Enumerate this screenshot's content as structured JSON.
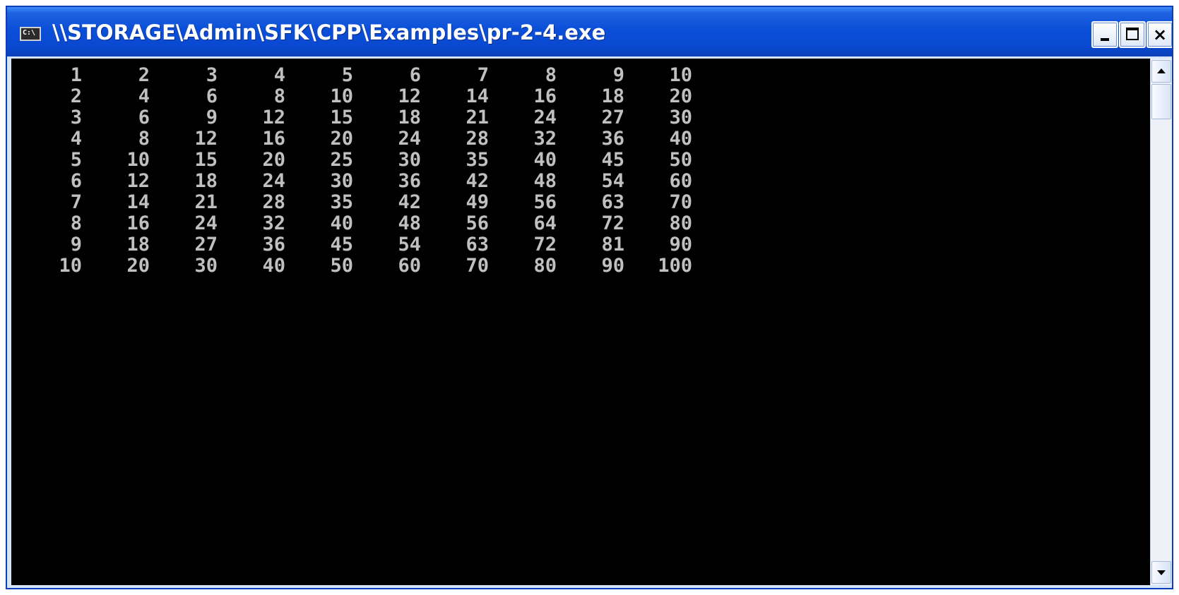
{
  "window": {
    "title": "\\\\STORAGE\\Admin\\SFK\\CPP\\Examples\\pr-2-4.exe",
    "icon": "console-icon",
    "icon_text": "C:\\",
    "controls": {
      "minimize_icon": "minimize-icon",
      "maximize_icon": "maximize-icon",
      "close_icon": "close-icon",
      "close_glyph": "×"
    }
  },
  "console": {
    "background": "#000000",
    "text_color": "#c0c0c0",
    "rows": [
      [
        "1",
        "2",
        "3",
        "4",
        "5",
        "6",
        "7",
        "8",
        "9",
        "10"
      ],
      [
        "2",
        "4",
        "6",
        "8",
        "10",
        "12",
        "14",
        "16",
        "18",
        "20"
      ],
      [
        "3",
        "6",
        "9",
        "12",
        "15",
        "18",
        "21",
        "24",
        "27",
        "30"
      ],
      [
        "4",
        "8",
        "12",
        "16",
        "20",
        "24",
        "28",
        "32",
        "36",
        "40"
      ],
      [
        "5",
        "10",
        "15",
        "20",
        "25",
        "30",
        "35",
        "40",
        "45",
        "50"
      ],
      [
        "6",
        "12",
        "18",
        "24",
        "30",
        "36",
        "42",
        "48",
        "54",
        "60"
      ],
      [
        "7",
        "14",
        "21",
        "28",
        "35",
        "42",
        "49",
        "56",
        "63",
        "70"
      ],
      [
        "8",
        "16",
        "24",
        "32",
        "40",
        "48",
        "56",
        "64",
        "72",
        "80"
      ],
      [
        "9",
        "18",
        "27",
        "36",
        "45",
        "54",
        "63",
        "72",
        "81",
        "90"
      ],
      [
        "10",
        "20",
        "30",
        "40",
        "50",
        "60",
        "70",
        "80",
        "90",
        "100"
      ]
    ]
  },
  "scrollbar": {
    "up_icon": "chevron-up-icon",
    "down_icon": "chevron-down-icon"
  },
  "colors": {
    "titlebar": "#0a49d0",
    "title_text": "#ffffff",
    "console_bg": "#000000",
    "console_fg": "#c0c0c0"
  }
}
